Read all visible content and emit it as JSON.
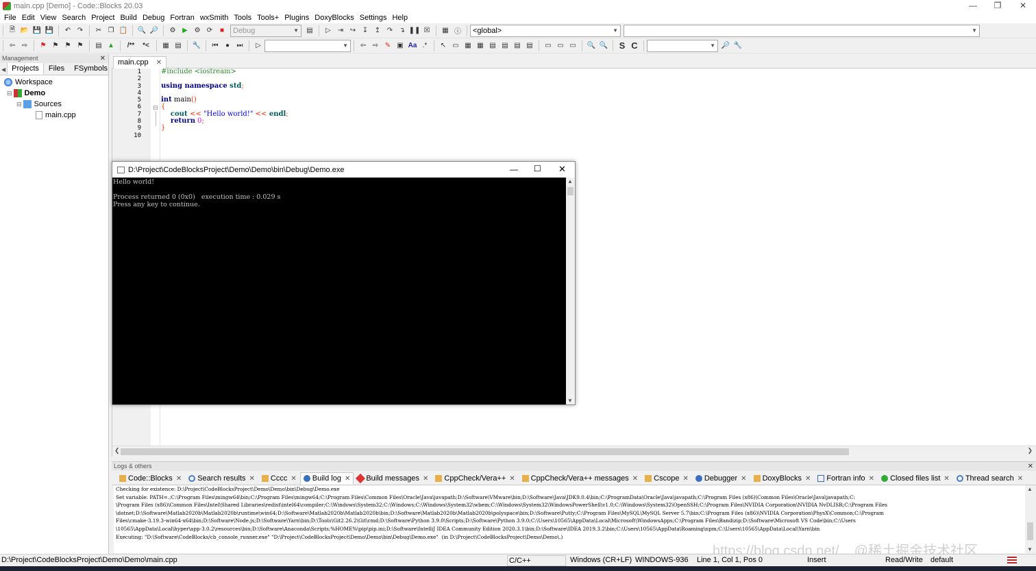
{
  "window": {
    "title": "main.cpp [Demo] - Code::Blocks 20.03"
  },
  "menu": [
    "File",
    "Edit",
    "View",
    "Search",
    "Project",
    "Build",
    "Debug",
    "Fortran",
    "wxSmith",
    "Tools",
    "Tools+",
    "Plugins",
    "DoxyBlocks",
    "Settings",
    "Help"
  ],
  "toolbar": {
    "build_target": "Debug",
    "scope": "<global>",
    "symbol": ""
  },
  "management": {
    "title": "Management",
    "tabs": [
      "Projects",
      "Files",
      "FSymbols"
    ],
    "tree": {
      "workspace": "Workspace",
      "project": "Demo",
      "folder": "Sources",
      "file": "main.cpp"
    }
  },
  "editor": {
    "tab": "main.cpp",
    "line_numbers": [
      "1",
      "2",
      "3",
      "4",
      "5",
      "6",
      "7",
      "8",
      "9",
      "10"
    ],
    "code": {
      "l1": "#include <iostream>",
      "l3a": "using namespace",
      "l3b": " std",
      "l3c": ";",
      "l5a": "int",
      "l5b": " main",
      "l5c": "()",
      "l6": "{",
      "l7a": "    cout ",
      "l7b": "<<",
      "l7c": " \"Hello world!\" ",
      "l7d": "<<",
      "l7e": " endl",
      "l7f": ";",
      "l8a": "    return",
      "l8b": " 0",
      "l8c": ";",
      "l9": "}"
    }
  },
  "console": {
    "title": "D:\\Project\\CodeBlocksProject\\Demo\\Demo\\bin\\Debug\\Demo.exe",
    "lines": [
      "Hello world!",
      "",
      "Process returned 0 (0x0)   execution time : 0.029 s",
      "Press any key to continue."
    ]
  },
  "logs": {
    "title": "Logs & others",
    "tabs": [
      "Code::Blocks",
      "Search results",
      "Cccc",
      "Build log",
      "Build messages",
      "CppCheck/Vera++",
      "CppCheck/Vera++ messages",
      "Cscope",
      "Debugger",
      "DoxyBlocks",
      "Fortran info",
      "Closed files list",
      "Thread search"
    ],
    "active_tab": "Build log",
    "lines": [
      "Checking for existence: D:\\Project\\CodeBlocksProject\\Demo\\Demo\\bin\\Debug\\Demo.exe",
      "Set variable: PATH=.;C:\\Program Files\\mingw64\\bin;C:\\Program Files\\mingw64;C:\\Program Files\\Common Files\\Oracle\\Java\\javapath;D:\\Software\\VMware\\bin;D:\\Software\\Java\\JDK9.0.4\\bin;C:\\ProgramData\\Oracle\\Java\\javapath;C:\\Program Files (x86)\\Common Files\\Oracle\\Java\\javapath;C:",
      "\\Program Files (x86)\\Common Files\\Intel\\Shared Libraries\\redist\\intel64\\compiler;C:\\Windows\\System32;C:\\Windows;C:\\Windows\\System32\\wbem;C:\\Windows\\System32\\WindowsPowerShell\\v1.0;C:\\Windows\\System32\\OpenSSH;C:\\Program Files\\NVIDIA Corporation\\NVIDIA NvDLISR;C:\\Program Files",
      "\\dotnet;D:\\Software\\Matlab2020b\\Matlab2020b\\runtime\\win64;D:\\Software\\Matlab2020b\\Matlab2020b\\bin;D:\\Software\\Matlab2020b\\Matlab2020b\\polyspace\\bin;D:\\Software\\Putty;C:\\Program Files\\MySQL\\MySQL Server 5.7\\bin;C:\\Program Files (x86)\\NVIDIA Corporation\\PhysX\\Common;C:\\Program",
      "Files\\cmake-3.19.3-win64-x64\\bin;D:\\Software\\Node.js;D:\\Software\\Yarn\\bin;D:\\Tools\\Git2.26.2\\Git\\cmd;D:\\Software\\Python 3.9.0\\Scripts;D:\\Software\\Python 3.9.0;C:\\Users\\10565\\AppData\\Local\\Microsoft\\WindowsApps;C:\\Program Files\\Bandizip;D:\\Software\\Microsoft VS Code\\bin;C:\\Users",
      "\\10565\\AppData\\Local\\hyper\\app-3.0.2\\resources\\bin;D:\\Software\\Anaconda\\Scripts;%HOME%\\pip\\pip.ini;D:\\Software\\IntelliJ IDEA Community Edition 2020.3.1\\bin;D:\\Software\\IDEA 2019.3.2\\bin;C:\\Users\\10565\\AppData\\Roaming\\npm;C:\\Users\\10565\\AppData\\Local\\Yarn\\bin",
      "Executing: \"D:\\Software\\CodeBlocks/cb_console_runner.exe\" \"D:\\Project\\CodeBlocksProject\\Demo\\Demo\\bin\\Debug\\Demo.exe\"  (in D:\\Project\\CodeBlocksProject\\Demo\\Demo\\.)"
    ]
  },
  "status": {
    "path": "D:\\Project\\CodeBlocksProject\\Demo\\Demo\\main.cpp",
    "lang": "C/C++",
    "eol": "Windows (CR+LF)",
    "encoding": "WINDOWS-936",
    "position": "Line 1, Col 1, Pos 0",
    "mode": "Insert",
    "access": "Read/Write",
    "profile": "default"
  },
  "watermark": "https://blog.csdn.net/...  @稀土掘金技术社区"
}
